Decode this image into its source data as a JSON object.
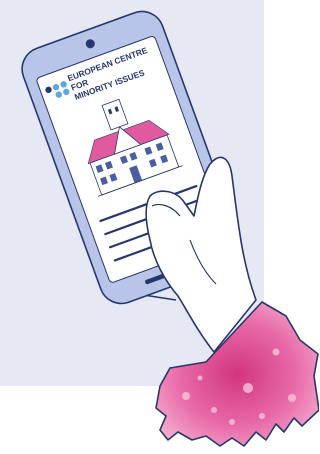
{
  "logo": {
    "line1": "EUROPEAN CENTRE",
    "line2": "FOR",
    "line3": "MINORITY ISSUES"
  },
  "colors": {
    "panel": "#e6e8f4",
    "phone_body": "#b9c4e9",
    "phone_outline": "#26376d",
    "screen": "#ffffff",
    "logo_dot_dark": "#26376d",
    "logo_dot_light": "#5ea7de",
    "building_roof": "#e15aa0",
    "sleeve": "#e86aa8",
    "hand_outline": "#26376d",
    "text_lines": "#26376d"
  },
  "illustration": {
    "subject": "hand holding smartphone",
    "screen_content": [
      "logo",
      "building",
      "text-lines"
    ],
    "icons": [
      "logo-dots-icon",
      "building-icon",
      "camera-icon",
      "home-bar-icon"
    ]
  }
}
